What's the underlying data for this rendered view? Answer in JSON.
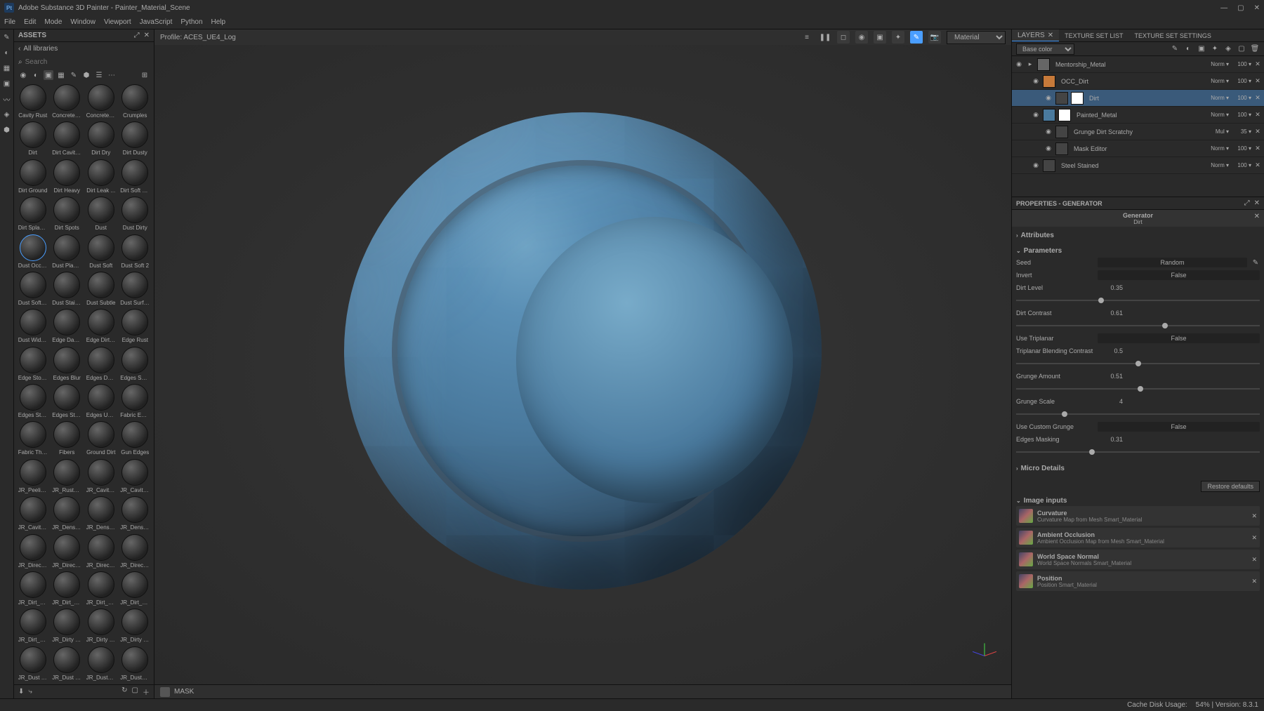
{
  "app_title": "Adobe Substance 3D Painter - Painter_Material_Scene",
  "menubar": [
    "File",
    "Edit",
    "Mode",
    "Window",
    "Viewport",
    "JavaScript",
    "Python",
    "Help"
  ],
  "assets": {
    "title": "ASSETS",
    "crumb": "All libraries",
    "search_placeholder": "Search",
    "items": [
      "Cavity Rust",
      "Concrete B...",
      "Concrete B...",
      "Crumples",
      "Dirt",
      "Dirt Cavities",
      "Dirt Dry",
      "Dirt Dusty",
      "Dirt Ground",
      "Dirt Heavy",
      "Dirt Leak ...",
      "Dirt Soft B...",
      "Dirt Splash...",
      "Dirt Spots",
      "Dust",
      "Dust Dirty",
      "Dust Occlu...",
      "Dust Plastic",
      "Dust Soft",
      "Dust Soft 2",
      "Dust Soft E...",
      "Dust Stained",
      "Dust Subtle",
      "Dust Surface",
      "Dust Wide ...",
      "Edge Dam...",
      "Edge Dirty ...",
      "Edge Rust",
      "Edge Stone...",
      "Edges Blur",
      "Edges Dusty",
      "Edges Scra...",
      "Edges Stro...",
      "Edges Stro...",
      "Edges Uber",
      "Fabric Edg...",
      "Fabric Thre...",
      "Fibers",
      "Ground Dirt",
      "Gun Edges",
      "JR_Peeling ...",
      "JR_Rust_Fine",
      "JR_Cavity_...",
      "JR_Cavity_...",
      "JR_Cavity_...",
      "JR_Densty ...",
      "JR_Densty ...",
      "JR_Densty ...",
      "JR_Directio...",
      "JR_Directio...",
      "JR_Directio...",
      "JR_Directio...",
      "JR_Dirt_Co...",
      "JR_Dirt_Fine",
      "JR_Dirt_Fine",
      "JR_Dirt_Me...",
      "JR_Dirt_St...",
      "JR_Dirty Le...",
      "JR_Dirty Le...",
      "JR_Dirty Le...",
      "JR_Dust St...",
      "JR_Dust St...",
      "JR_Dust_Fi...",
      "JR_Dust_Fi..."
    ],
    "selected_index": 16
  },
  "viewport": {
    "profile": "Profile: ACES_UE4_Log",
    "material_dropdown": "Material",
    "mask_label": "MASK"
  },
  "layers": {
    "tabs": [
      "LAYERS",
      "TEXTURE SET LIST",
      "TEXTURE SET SETTINGS"
    ],
    "channel": "Base color",
    "items": [
      {
        "type": "folder",
        "name": "Mentorship_Metal",
        "blend": "Norm",
        "opac": "100",
        "indent": 0,
        "vis": true
      },
      {
        "type": "layer",
        "name": "OCC_Dirt",
        "blend": "Norm",
        "opac": "100",
        "indent": 1,
        "vis": true,
        "thumb": "orange"
      },
      {
        "type": "effect",
        "name": "Dirt",
        "blend": "Norm",
        "opac": "100",
        "indent": 2,
        "vis": true,
        "selected": true,
        "mask": true
      },
      {
        "type": "layer",
        "name": "Painted_Metal",
        "blend": "Norm",
        "opac": "100",
        "indent": 1,
        "vis": true,
        "thumb": "blue",
        "mask": true
      },
      {
        "type": "effect",
        "name": "Grunge Dirt Scratchy",
        "blend": "Mul",
        "opac": "35",
        "indent": 2,
        "vis": true
      },
      {
        "type": "effect",
        "name": "Mask Editor",
        "blend": "Norm",
        "opac": "100",
        "indent": 2,
        "vis": true
      },
      {
        "type": "layer",
        "name": "Steel Stained",
        "blend": "Norm",
        "opac": "100",
        "indent": 1,
        "vis": true,
        "thumb": "default"
      }
    ]
  },
  "properties": {
    "title": "PROPERTIES - GENERATOR",
    "gen_name": "Generator",
    "gen_sub": "Dirt",
    "sections": {
      "attributes": "Attributes",
      "parameters": "Parameters",
      "micro": "Micro Details",
      "image_inputs": "Image inputs"
    },
    "params": {
      "seed": {
        "label": "Seed",
        "value": "Random"
      },
      "invert": {
        "label": "Invert",
        "value": "False"
      },
      "dirt_level": {
        "label": "Dirt Level",
        "value": "0.35",
        "pos": 35
      },
      "dirt_contrast": {
        "label": "Dirt Contrast",
        "value": "0.61",
        "pos": 61
      },
      "use_triplanar": {
        "label": "Use Triplanar",
        "value": "False"
      },
      "triplanar_blend": {
        "label": "Triplanar Blending Contrast",
        "value": "0.5",
        "pos": 50
      },
      "grunge_amount": {
        "label": "Grunge Amount",
        "value": "0.51",
        "pos": 51
      },
      "grunge_scale": {
        "label": "Grunge Scale",
        "value": "4",
        "pos": 20
      },
      "use_custom_grunge": {
        "label": "Use Custom Grunge",
        "value": "False"
      },
      "edges_masking": {
        "label": "Edges Masking",
        "value": "0.31",
        "pos": 31
      }
    },
    "restore": "Restore defaults",
    "image_inputs": [
      {
        "title": "Curvature",
        "sub": "Curvature Map from Mesh Smart_Material"
      },
      {
        "title": "Ambient Occlusion",
        "sub": "Ambient Occlusion Map from Mesh Smart_Material"
      },
      {
        "title": "World Space Normal",
        "sub": "World Space Normals Smart_Material"
      },
      {
        "title": "Position",
        "sub": "Position Smart_Material"
      }
    ]
  },
  "status": {
    "cache": "Cache Disk Usage:",
    "version": "54% | Version: 8.3.1"
  }
}
